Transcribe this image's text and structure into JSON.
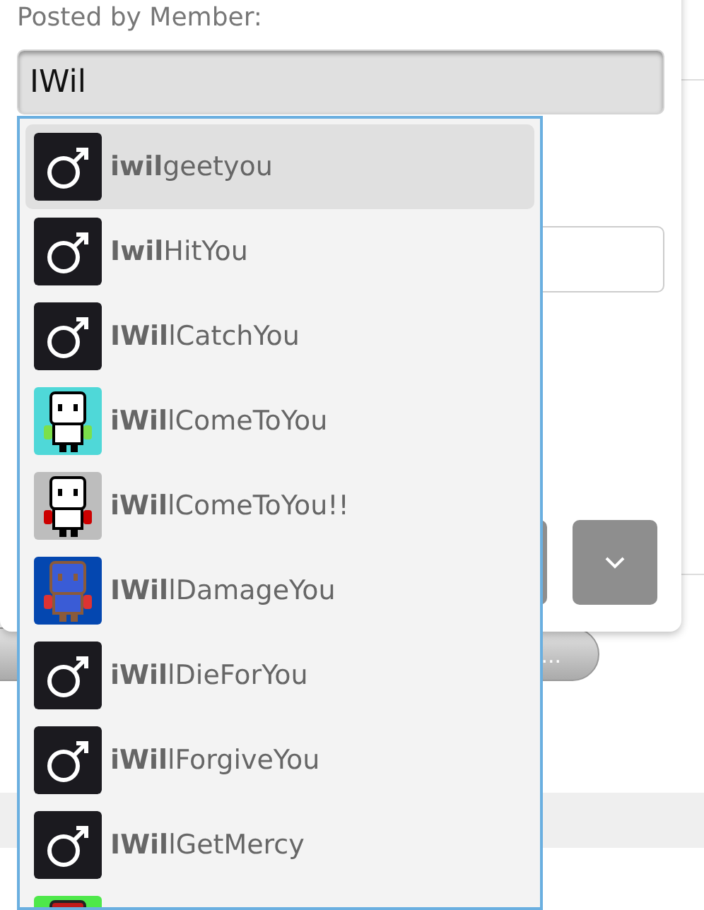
{
  "form": {
    "label": "Posted by Member:",
    "member_field": {
      "value": "IWil"
    },
    "pill_button": {
      "label": "..."
    }
  },
  "suggestions": [
    {
      "name": "**iwil**geetyou",
      "kind": "male",
      "selected": true
    },
    {
      "name": "**Iwil**HitYou",
      "kind": "male",
      "selected": false
    },
    {
      "name": "**IWil**lCatchYou",
      "kind": "male",
      "selected": false
    },
    {
      "name": "**iWil**lComeToYou",
      "kind": "picture",
      "selected": false
    },
    {
      "name": "**iWil**lComeToYou!!",
      "kind": "picture",
      "selected": false
    },
    {
      "name": "**IWil**lDamageYou",
      "kind": "picture",
      "selected": false
    },
    {
      "name": "**iWil**lDieForYou",
      "kind": "male",
      "selected": false
    },
    {
      "name": "**iWil**lForgiveYou",
      "kind": "male",
      "selected": false
    },
    {
      "name": "**IWil**lGetMercy",
      "kind": "male",
      "selected": false
    },
    {
      "kind": "picture",
      "selected": false
    }
  ]
}
